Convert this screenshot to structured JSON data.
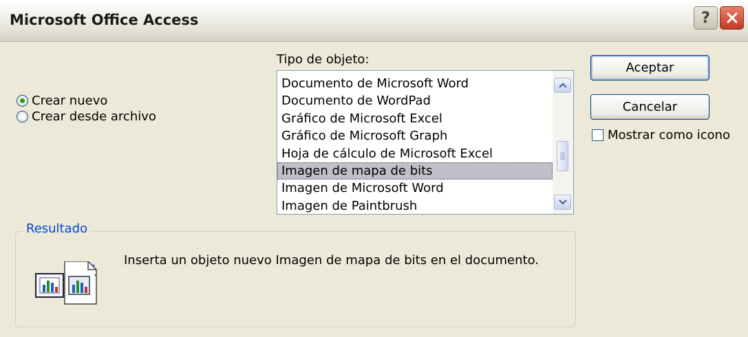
{
  "window": {
    "title": "Microsoft Office Access",
    "help_label": "?",
    "close_icon": "close-x-icon"
  },
  "options": {
    "create_new": "Crear nuevo",
    "create_from_file": "Crear desde archivo",
    "selected": "create_new"
  },
  "object_type": {
    "label": "Tipo de objeto:",
    "items": [
      "Documento de Microsoft Word",
      "Documento de WordPad",
      "Gráfico de Microsoft Excel",
      "Gráfico de Microsoft Graph",
      "Hoja de cálculo de Microsoft Excel",
      "Imagen de mapa de bits",
      "Imagen de Microsoft Word",
      "Imagen de Paintbrush"
    ],
    "selected_index": 5
  },
  "buttons": {
    "ok": "Aceptar",
    "cancel": "Cancelar"
  },
  "show_as_icon": {
    "label": "Mostrar como icono",
    "checked": false
  },
  "result": {
    "legend": "Resultado",
    "text": "Inserta un objeto nuevo Imagen de mapa de bits en el documento.",
    "icon": "bitmap-objects-icon"
  },
  "colors": {
    "dialog_bg": "#ece9d8",
    "selection": "#c0c0c8",
    "legend_text": "#0046d5",
    "close_button": "#c43a20"
  }
}
